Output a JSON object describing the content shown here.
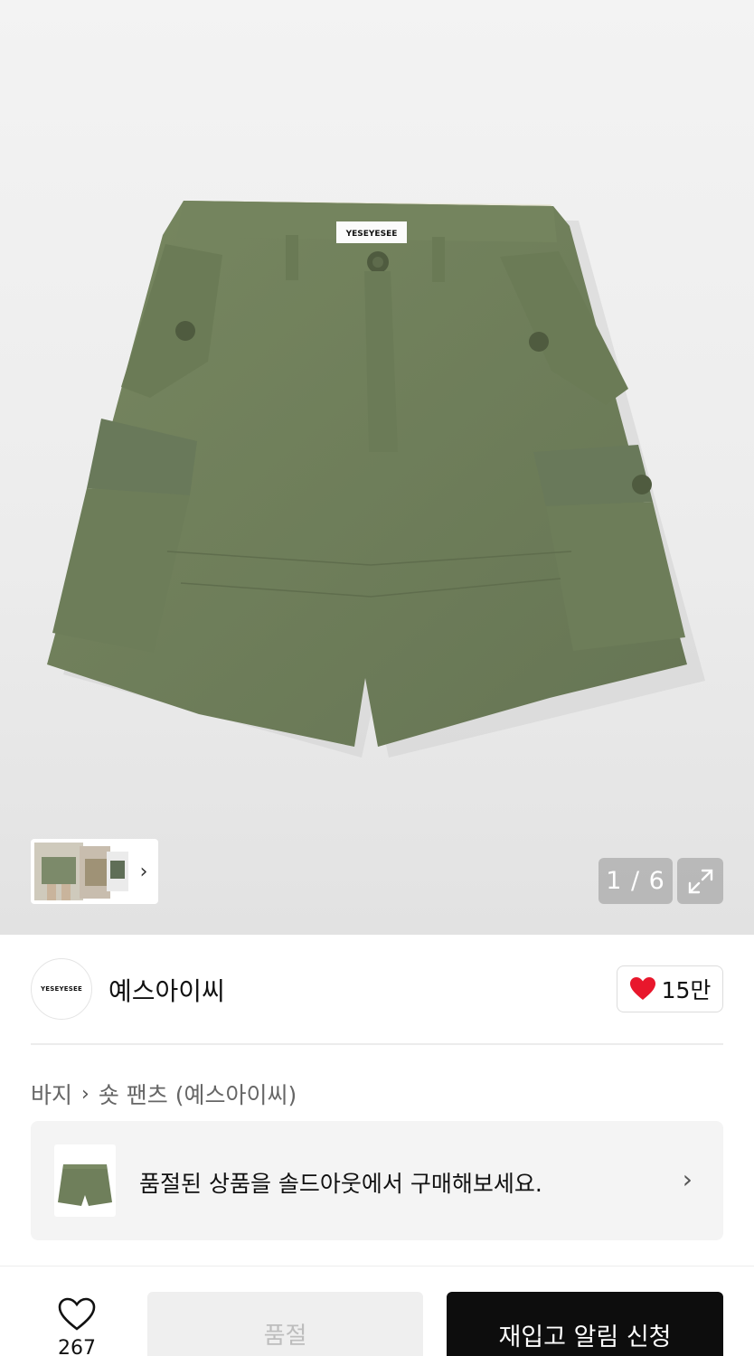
{
  "gallery": {
    "counter": "1 / 6",
    "garment_label": "YESEYESEE",
    "colors": {
      "garment": "#6f7f5b",
      "background": "#efefef"
    }
  },
  "brand": {
    "logo_text": "YESEYESEE",
    "name": "예스아이씨",
    "likes": "15만",
    "like_color": "#e8172c"
  },
  "breadcrumb": {
    "category": "바지",
    "subcategory": "숏 팬츠 (예스아이씨)"
  },
  "banner": {
    "text": "품절된 상품을 솔드아웃에서 구매해보세요."
  },
  "bottom_bar": {
    "wish_count": "267",
    "soldout_label": "품절",
    "restock_label": "재입고 알림 신청"
  }
}
